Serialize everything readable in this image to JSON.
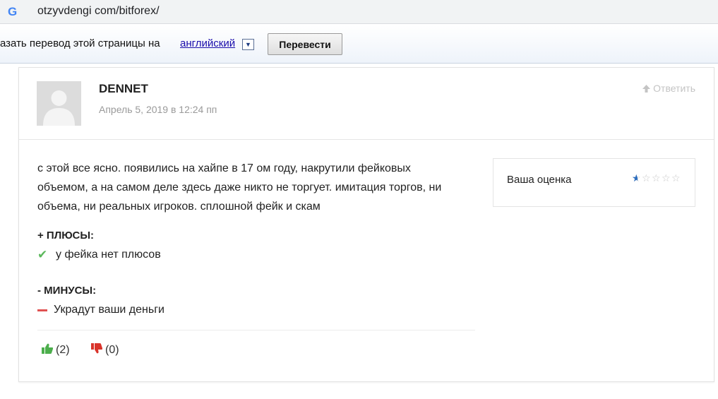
{
  "browser": {
    "logo": "G",
    "url": "otzyvdengi com/bitforex/"
  },
  "translate": {
    "prompt": "азать перевод этой страницы на",
    "language": "английский",
    "dropdown": "▼",
    "button": "Перевести"
  },
  "comment": {
    "author": "DENNET",
    "date": "Апрель 5, 2019 в 12:24 пп",
    "reply": "Ответить",
    "text": "с этой все ясно. появились на хайпе в 17 ом году, накрутили фейковых объемом, а на самом деле здесь даже никто не торгует. имитация торгов, ни объема, ни реальных игроков. сплошной фейк и скам",
    "pros_title": "+ ПЛЮСЫ:",
    "pros": [
      "у фейка нет плюсов"
    ],
    "cons_title": "- МИНУСЫ:",
    "cons": [
      "Украдут ваши деньги"
    ],
    "likes": "(2)",
    "dislikes": "(0)"
  },
  "rating": {
    "label": "Ваша оценка",
    "value": 0.6,
    "max": 5,
    "fill_color": "#2f6fbf"
  }
}
